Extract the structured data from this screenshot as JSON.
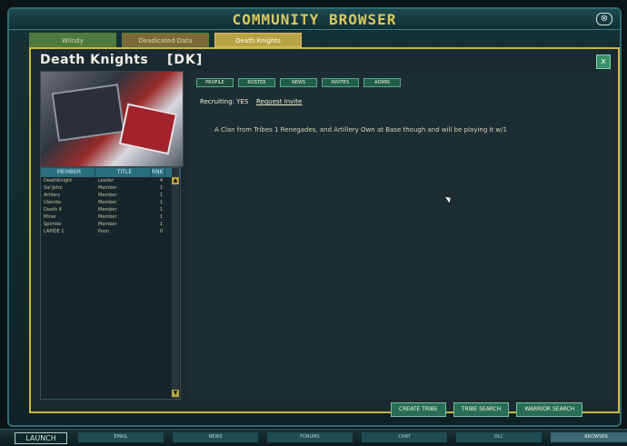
{
  "window": {
    "title": "COMMUNITY BROWSER",
    "close_glyph": "⊗"
  },
  "tabs": [
    {
      "label": "Wiindy"
    },
    {
      "label": "Deadicated Data"
    },
    {
      "label": "Death Knights"
    }
  ],
  "tribe": {
    "name": "Death Knights",
    "tag": "[DK]",
    "recruiting": "Recruiting: YES",
    "request_invite": "Request Invite",
    "description": "A Clan from Tribes 1 Renegades, and Artillery   Own at Base though and will be playing it w/1"
  },
  "member_table": {
    "headers": [
      "MEMBER",
      "TITLE",
      "RNK"
    ],
    "rows": [
      [
        "DeathKnight",
        "Leader",
        "4"
      ],
      [
        "Sol Jetro",
        "Member",
        "1"
      ],
      [
        "Artilery",
        "Member",
        "1"
      ],
      [
        "Ulanide",
        "Member",
        "1"
      ],
      [
        "Death 4",
        "Member",
        "1"
      ],
      [
        "Miner",
        "Member",
        "1"
      ],
      [
        "Spirride",
        "Member",
        "1"
      ],
      [
        "LAPIDE 1",
        "Peon",
        "0"
      ]
    ]
  },
  "subtabs": [
    "PROFILE",
    "ROSTER",
    "NEWS",
    "INVITES",
    "ADMIN"
  ],
  "buttons": {
    "create": "CREATE TRIBE",
    "search": "TRIBE SEARCH",
    "warrior": "WARRIOR SEARCH"
  },
  "taskbar": {
    "launch": "LAUNCH",
    "items": [
      "EMAIL",
      "NEWS",
      "FORUMS",
      "CHAT",
      "DLC",
      "BROWSER"
    ]
  }
}
